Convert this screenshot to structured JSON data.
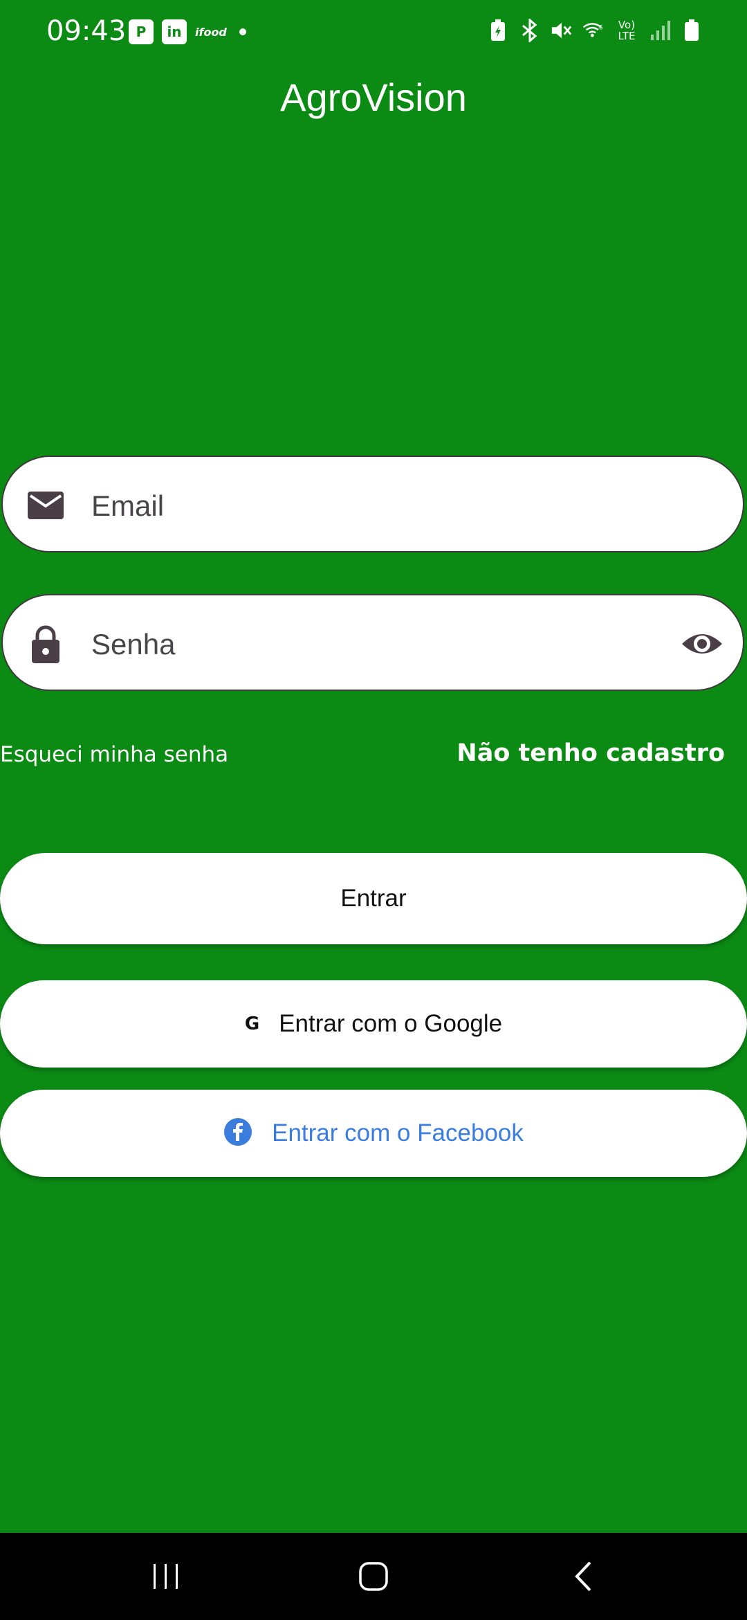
{
  "status_bar": {
    "time": "09:43",
    "left_icons": [
      "p-badge-icon",
      "linkedin-icon",
      "ifood-icon",
      "notification-dot-icon"
    ],
    "ifood_text": "ifood",
    "linkedin_text": "in",
    "p_badge_text": "P",
    "right_icons": [
      "battery-saver-icon",
      "bluetooth-icon",
      "mute-icon",
      "wifi-icon",
      "volte-icon",
      "signal-icon",
      "battery-icon"
    ],
    "volte_text": "Vo) LTE"
  },
  "app": {
    "title": "AgroVision"
  },
  "form": {
    "email_placeholder": "Email",
    "password_placeholder": "Senha",
    "forgot_password": "Esqueci minha senha",
    "register": "Não tenho cadastro"
  },
  "buttons": {
    "enter": "Entrar",
    "google": "Entrar com o Google",
    "google_icon_text": "G",
    "facebook": "Entrar com o Facebook"
  },
  "colors": {
    "background": "#0b8a14",
    "facebook_blue": "#3b7ddd",
    "input_icon": "#4a3f47"
  },
  "nav_bar": {
    "icons": [
      "recent-apps-icon",
      "home-icon",
      "back-icon"
    ]
  }
}
